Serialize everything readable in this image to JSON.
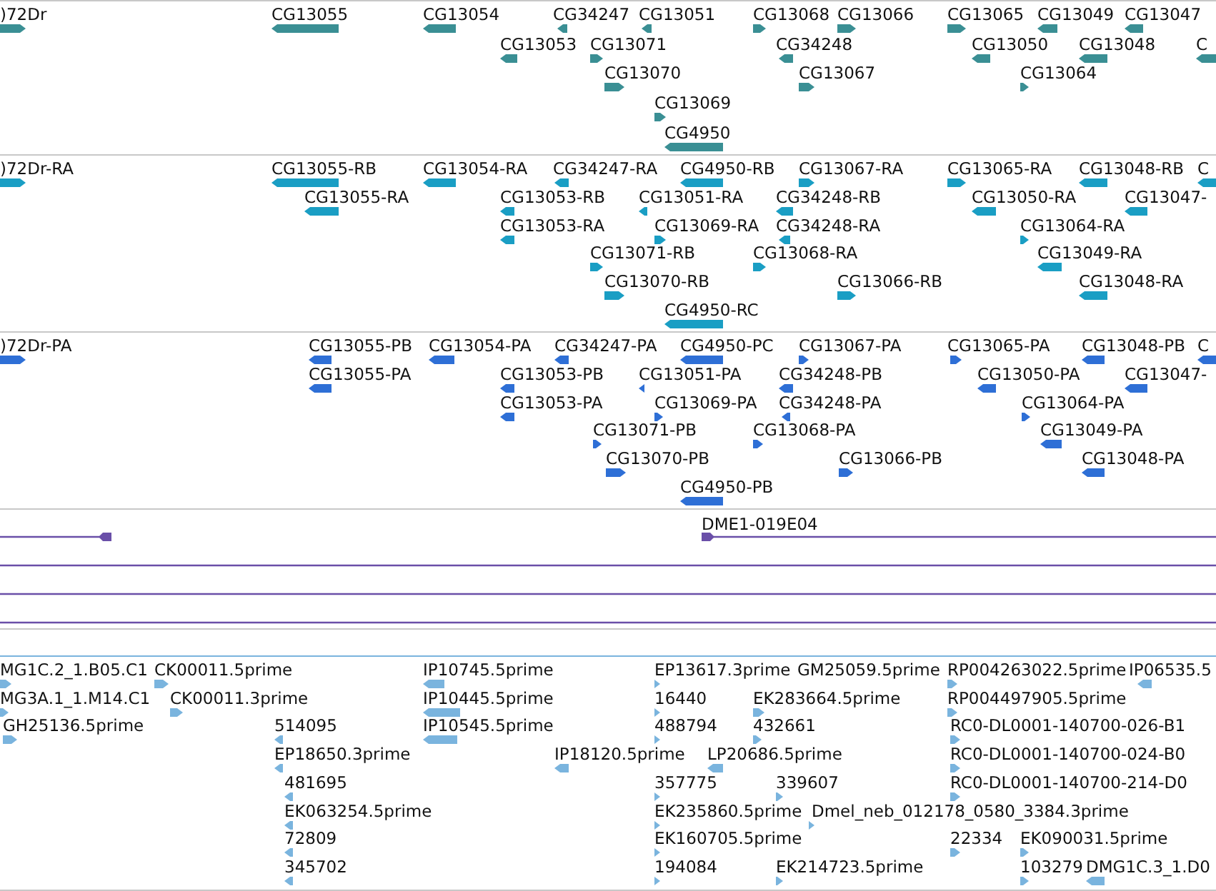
{
  "tracks": [
    {
      "kind": "gene",
      "features": [
        {
          "label": ")72Dr",
          "forward": true
        },
        {
          "label": "CG13055",
          "forward": false
        },
        {
          "label": "CG13054",
          "forward": false
        },
        {
          "label": "CG34247",
          "forward": false
        },
        {
          "label": "CG13051",
          "forward": false
        },
        {
          "label": "CG13068",
          "forward": true
        },
        {
          "label": "CG13066",
          "forward": true
        },
        {
          "label": "CG13065",
          "forward": true
        },
        {
          "label": "CG13049",
          "forward": false
        },
        {
          "label": "CG13047",
          "forward": false
        },
        {
          "label": "CG13053",
          "forward": false
        },
        {
          "label": "CG13071",
          "forward": true
        },
        {
          "label": "CG34248",
          "forward": false
        },
        {
          "label": "CG13050",
          "forward": false
        },
        {
          "label": "CG13048",
          "forward": false
        },
        {
          "label": "C",
          "forward": false
        },
        {
          "label": "CG13070",
          "forward": true
        },
        {
          "label": "CG13067",
          "forward": true
        },
        {
          "label": "CG13064",
          "forward": true
        },
        {
          "label": "CG13069",
          "forward": true
        },
        {
          "label": "CG4950",
          "forward": false
        }
      ]
    },
    {
      "kind": "transcript",
      "features": [
        {
          "label": ")72Dr-RA",
          "forward": true
        },
        {
          "label": "CG13055-RB",
          "forward": false
        },
        {
          "label": "CG13054-RA",
          "forward": false
        },
        {
          "label": "CG34247-RA",
          "forward": false
        },
        {
          "label": "CG4950-RB",
          "forward": false
        },
        {
          "label": "CG13067-RA",
          "forward": true
        },
        {
          "label": "CG13065-RA",
          "forward": true
        },
        {
          "label": "CG13048-RB",
          "forward": false
        },
        {
          "label": "C",
          "forward": false
        },
        {
          "label": "CG13055-RA",
          "forward": false
        },
        {
          "label": "CG13053-RB",
          "forward": false
        },
        {
          "label": "CG13051-RA",
          "forward": false
        },
        {
          "label": "CG34248-RB",
          "forward": false
        },
        {
          "label": "CG13050-RA",
          "forward": false
        },
        {
          "label": "CG13047-",
          "forward": false
        },
        {
          "label": "CG13053-RA",
          "forward": false
        },
        {
          "label": "CG13069-RA",
          "forward": true
        },
        {
          "label": "CG34248-RA",
          "forward": false
        },
        {
          "label": "CG13064-RA",
          "forward": true
        },
        {
          "label": "CG13071-RB",
          "forward": true
        },
        {
          "label": "CG13068-RA",
          "forward": true
        },
        {
          "label": "CG13049-RA",
          "forward": false
        },
        {
          "label": "CG13070-RB",
          "forward": true
        },
        {
          "label": "CG13066-RB",
          "forward": true
        },
        {
          "label": "CG13048-RA",
          "forward": false
        },
        {
          "label": "CG4950-RC",
          "forward": false
        }
      ]
    },
    {
      "kind": "polypeptide",
      "features": [
        {
          "label": ")72Dr-PA",
          "forward": true
        },
        {
          "label": "CG13055-PB",
          "forward": false
        },
        {
          "label": "CG13054-PA",
          "forward": false
        },
        {
          "label": "CG34247-PA",
          "forward": false
        },
        {
          "label": "CG4950-PC",
          "forward": false
        },
        {
          "label": "CG13067-PA",
          "forward": true
        },
        {
          "label": "CG13065-PA",
          "forward": true
        },
        {
          "label": "CG13048-PB",
          "forward": false
        },
        {
          "label": "C",
          "forward": false
        },
        {
          "label": "CG13055-PA",
          "forward": false
        },
        {
          "label": "CG13053-PB",
          "forward": false
        },
        {
          "label": "CG13051-PA",
          "forward": false
        },
        {
          "label": "CG34248-PB",
          "forward": false
        },
        {
          "label": "CG13050-PA",
          "forward": false
        },
        {
          "label": "CG13047-",
          "forward": false
        },
        {
          "label": "CG13053-PA",
          "forward": false
        },
        {
          "label": "CG13069-PA",
          "forward": true
        },
        {
          "label": "CG34248-PA",
          "forward": false
        },
        {
          "label": "CG13064-PA",
          "forward": true
        },
        {
          "label": "CG13071-PB",
          "forward": true
        },
        {
          "label": "CG13068-PA",
          "forward": true
        },
        {
          "label": "CG13049-PA",
          "forward": false
        },
        {
          "label": "CG13070-PB",
          "forward": true
        },
        {
          "label": "CG13066-PB",
          "forward": true
        },
        {
          "label": "CG13048-PA",
          "forward": false
        },
        {
          "label": "CG4950-PB",
          "forward": false
        }
      ]
    },
    {
      "kind": "clone",
      "features": [
        {
          "kind": "clone",
          "forward": false
        },
        {
          "kind": "clone",
          "label": "DME1-019E04",
          "forward": true
        },
        {
          "kind": "span"
        },
        {
          "kind": "span"
        },
        {
          "kind": "span"
        }
      ]
    },
    {
      "kind": "est",
      "features": [
        {
          "label": "MG1C.2_1.B05.C1",
          "forward": true
        },
        {
          "label": "CK00011.5prime",
          "forward": true
        },
        {
          "label": "IP10745.5prime",
          "forward": false
        },
        {
          "label": "EP13617.3prime",
          "forward": true
        },
        {
          "label": "GM25059.5prime"
        },
        {
          "label": "RP004263022.5prime",
          "forward": true
        },
        {
          "label": "IP06535.5",
          "forward": false
        },
        {
          "label": "MG3A.1_1.M14.C1",
          "forward": true
        },
        {
          "label": "CK00011.3prime",
          "forward": true
        },
        {
          "label": "IP10445.5prime",
          "forward": false
        },
        {
          "label": "16440",
          "forward": true
        },
        {
          "label": "EK283664.5prime",
          "forward": true
        },
        {
          "label": "RP004497905.5prime",
          "forward": true
        },
        {
          "label": "GH25136.5prime",
          "forward": true
        },
        {
          "label": "514095",
          "forward": false
        },
        {
          "label": "IP10545.5prime",
          "forward": false
        },
        {
          "label": "488794",
          "forward": true
        },
        {
          "label": "432661",
          "forward": true
        },
        {
          "label": "RC0-DL0001-140700-026-B1",
          "forward": true
        },
        {
          "label": "EP18650.3prime",
          "forward": false
        },
        {
          "label": "IP18120.5prime",
          "forward": false
        },
        {
          "label": "LP20686.5prime",
          "forward": false
        },
        {
          "label": "RC0-DL0001-140700-024-B0",
          "forward": true
        },
        {
          "label": "481695",
          "forward": false
        },
        {
          "label": "357775",
          "forward": true
        },
        {
          "label": "339607",
          "forward": true
        },
        {
          "label": "RC0-DL0001-140700-214-D0",
          "forward": true
        },
        {
          "label": "EK063254.5prime",
          "forward": false
        },
        {
          "label": "EK235860.5prime",
          "forward": true
        },
        {
          "label": "Dmel_neb_012178_0580_3384.3prime",
          "forward": true
        },
        {
          "label": "72809",
          "forward": false
        },
        {
          "label": "EK160705.5prime",
          "forward": true
        },
        {
          "label": "22334",
          "forward": true
        },
        {
          "label": "EK090031.5prime",
          "forward": true
        },
        {
          "label": "345702",
          "forward": false
        },
        {
          "label": "194084",
          "forward": true
        },
        {
          "label": "EK214723.5prime",
          "forward": true
        },
        {
          "label": "103279",
          "forward": true
        },
        {
          "label": "DMG1C.3_1.D0",
          "forward": false
        }
      ]
    }
  ]
}
